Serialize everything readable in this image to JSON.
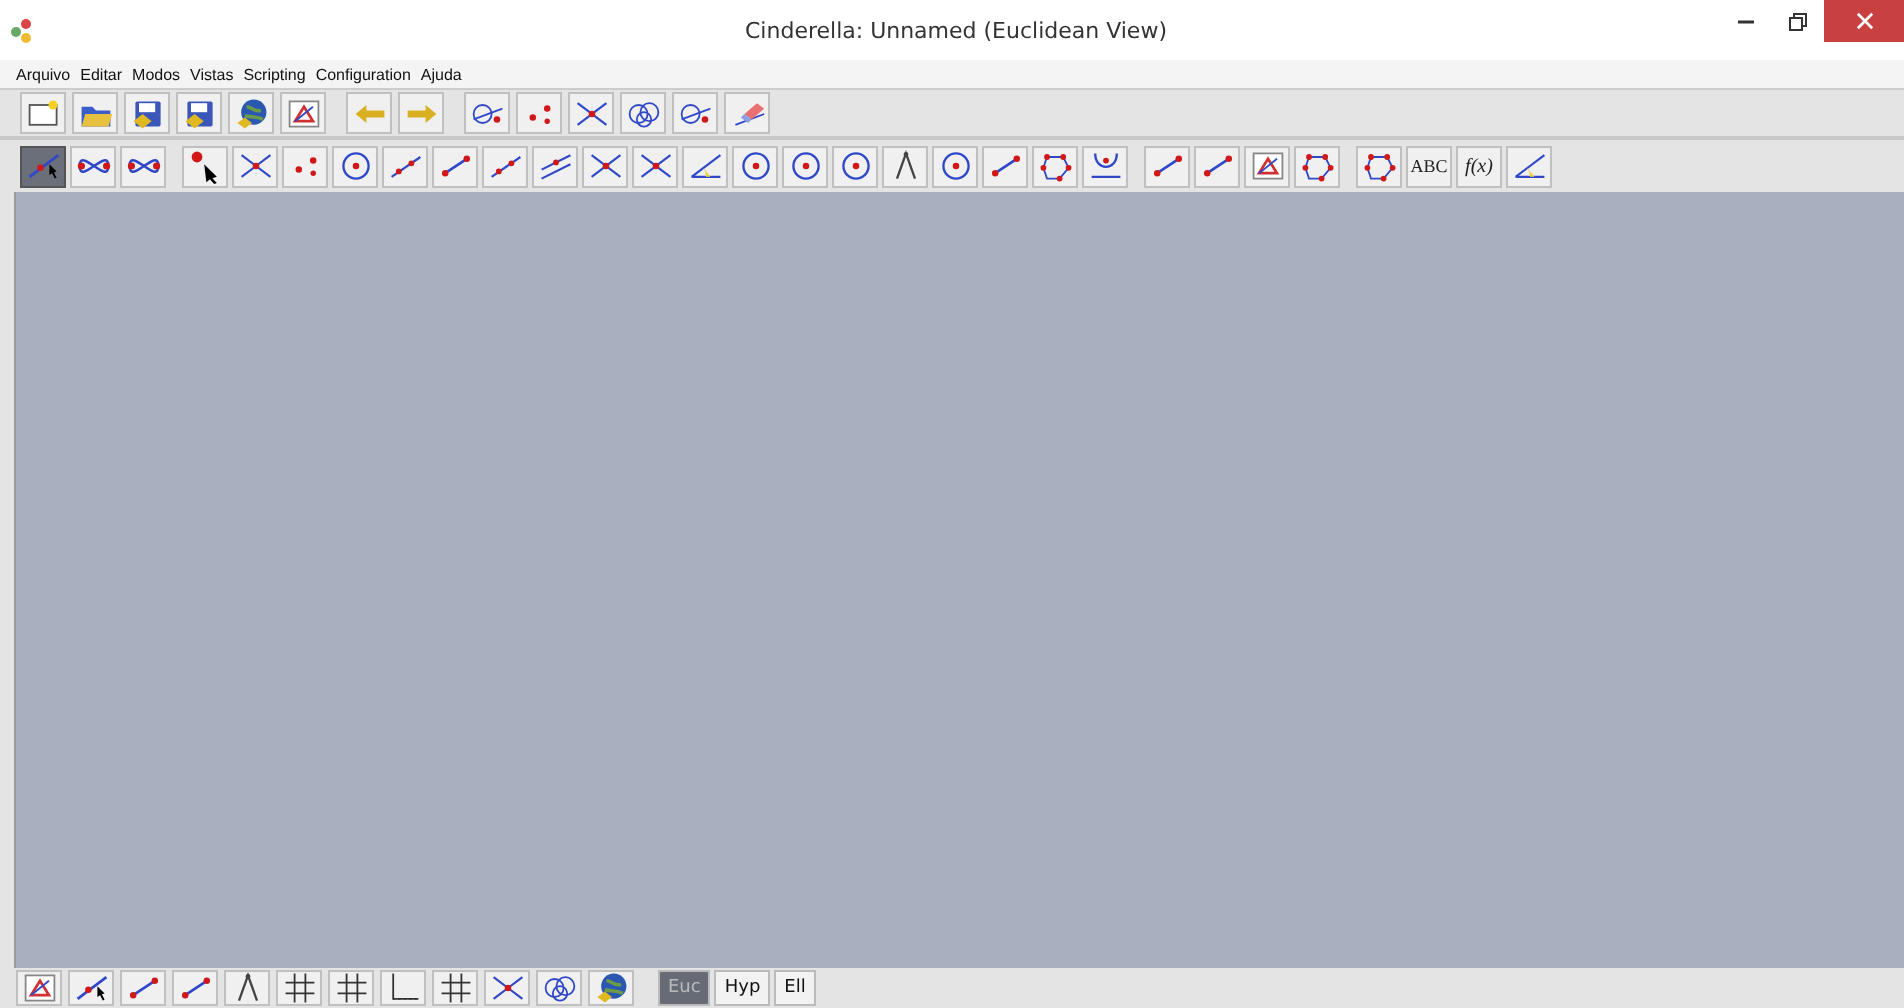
{
  "window": {
    "title": "Cinderella: Unnamed (Euclidean View)"
  },
  "menu": [
    "Arquivo",
    "Editar",
    "Modos",
    "Vistas",
    "Scripting",
    "Configuration",
    "Ajuda"
  ],
  "mode_toolbar": {
    "groups": [
      [
        {
          "selected": true
        },
        {
          "selected": false
        },
        {
          "selected": false
        }
      ],
      [
        {
          "selected": false
        },
        {
          "selected": false
        },
        {
          "selected": false
        },
        {
          "selected": false
        },
        {
          "selected": false
        },
        {
          "selected": false
        },
        {
          "selected": false
        },
        {
          "selected": false
        },
        {
          "selected": false
        },
        {
          "selected": false
        },
        {
          "selected": false
        },
        {
          "selected": false
        },
        {
          "selected": false
        },
        {
          "selected": false
        },
        {
          "selected": false
        },
        {
          "selected": false
        },
        {
          "selected": false
        },
        {
          "selected": false
        },
        {
          "selected": false
        }
      ],
      [
        {
          "selected": false
        },
        {
          "selected": false
        },
        {
          "selected": false
        },
        {
          "selected": false
        }
      ],
      [
        {
          "selected": false
        },
        {
          "selected": false,
          "label": "ABC"
        },
        {
          "selected": false,
          "label": "f(x)"
        },
        {
          "selected": false
        }
      ]
    ]
  },
  "geometry_buttons": [
    {
      "label": "Euc",
      "selected": true
    },
    {
      "label": "Hyp",
      "selected": false
    },
    {
      "label": "Ell",
      "selected": false
    }
  ]
}
